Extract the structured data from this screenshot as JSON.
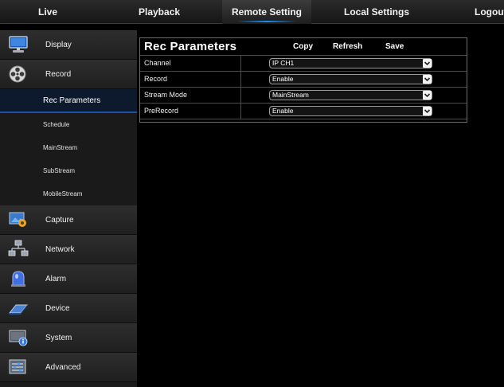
{
  "topnav": {
    "tabs": [
      {
        "label": "Live"
      },
      {
        "label": "Playback"
      },
      {
        "label": "Remote Setting"
      },
      {
        "label": "Local Settings"
      },
      {
        "label": "Logout"
      }
    ],
    "active_index": 2
  },
  "sidebar": {
    "main_items": [
      {
        "label": "Display",
        "icon": "monitor-icon"
      },
      {
        "label": "Record",
        "icon": "film-reel-icon"
      }
    ],
    "sub_items": [
      {
        "label": "Rec Parameters",
        "active": true
      },
      {
        "label": "Schedule"
      },
      {
        "label": "MainStream"
      },
      {
        "label": "SubStream"
      },
      {
        "label": "MobileStream"
      }
    ],
    "lower_items": [
      {
        "label": "Capture",
        "icon": "capture-icon"
      },
      {
        "label": "Network",
        "icon": "network-icon"
      },
      {
        "label": "Alarm",
        "icon": "alarm-icon"
      },
      {
        "label": "Device",
        "icon": "device-icon"
      },
      {
        "label": "System",
        "icon": "system-icon"
      },
      {
        "label": "Advanced",
        "icon": "advanced-icon"
      }
    ]
  },
  "panel": {
    "title": "Rec Parameters",
    "buttons": {
      "copy": "Copy",
      "refresh": "Refresh",
      "save": "Save"
    },
    "rows": [
      {
        "label": "Channel",
        "value": "IP CH1"
      },
      {
        "label": "Record",
        "value": "Enable"
      },
      {
        "label": "Stream Mode",
        "value": "MainStream"
      },
      {
        "label": "PreRecord",
        "value": "Enable"
      }
    ]
  },
  "colors": {
    "background": "#000000",
    "active_underline": "#1a8cff",
    "active_sub_bg": "#0d1a2d"
  }
}
